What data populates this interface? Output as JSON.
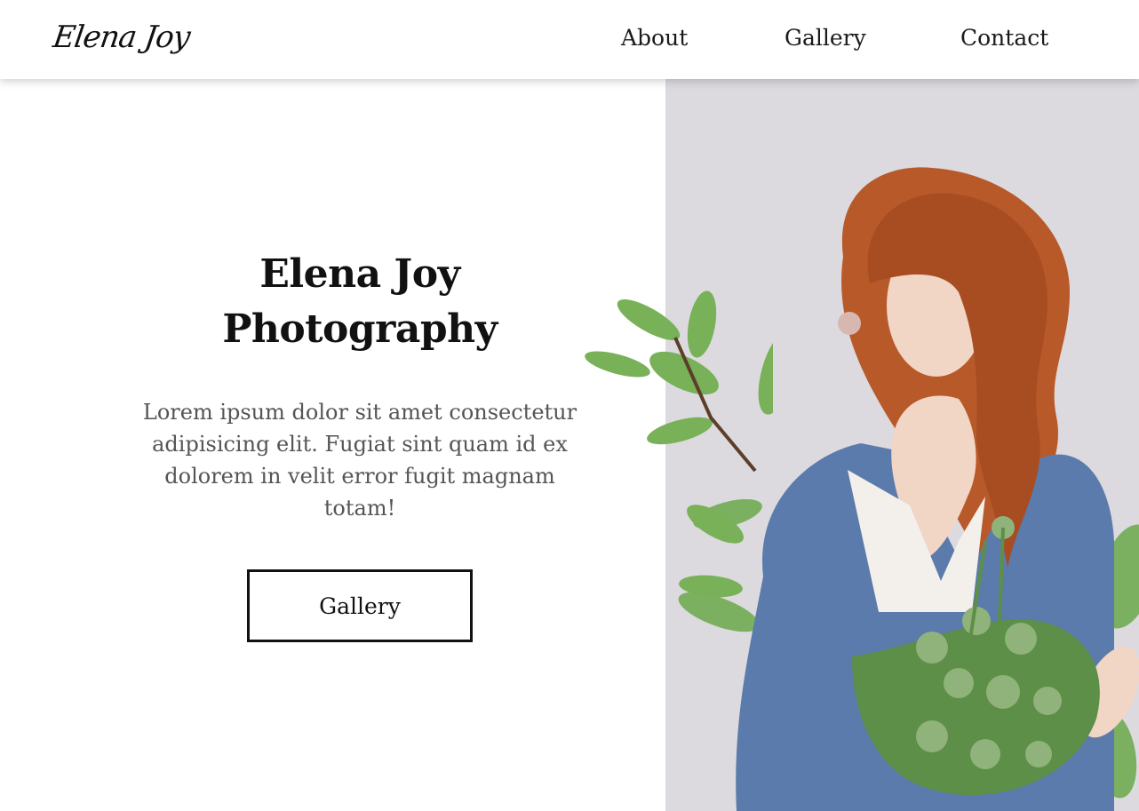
{
  "header": {
    "logo_text": "Elena Joy",
    "nav": {
      "about": "About",
      "gallery": "Gallery",
      "contact": "Contact"
    }
  },
  "hero": {
    "title_line1": "Elena Joy",
    "title_line2": "Photography",
    "text": "Lorem ipsum dolor sit amet consectetur adipisicing elit. Fugiat sint quam id ex dolorem in velit error fugit magnam totam!",
    "button_label": "Gallery",
    "photo": {
      "background_color": "#dcdadf",
      "hair_color": "#b8592a",
      "sweater_color": "#5a7bab",
      "top_color": "#f3f0ec",
      "skin_color": "#f1d5c5",
      "leaf_color": "#6aa84a"
    }
  }
}
